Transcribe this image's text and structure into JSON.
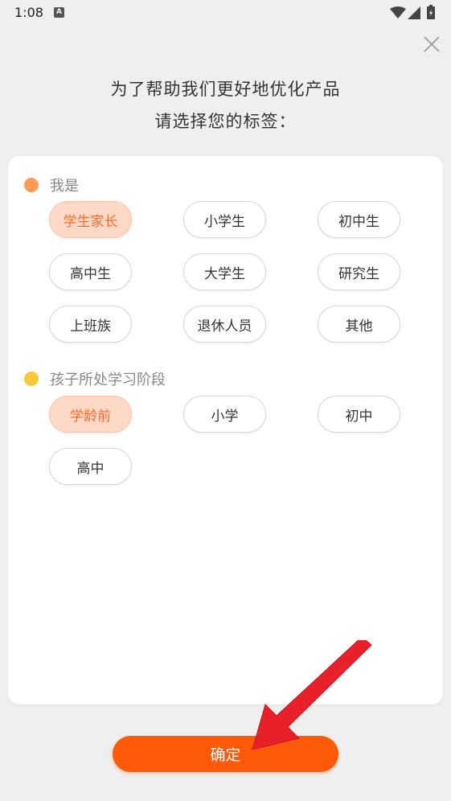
{
  "status_bar": {
    "time": "1:08",
    "notification_icon": "A"
  },
  "header": {
    "line1": "为了帮助我们更好地优化产品",
    "line2": "请选择您的标签："
  },
  "sections": [
    {
      "title": "我是",
      "dot_color": "#ff9a57",
      "options": [
        {
          "label": "学生家长",
          "selected": true
        },
        {
          "label": "小学生",
          "selected": false
        },
        {
          "label": "初中生",
          "selected": false
        },
        {
          "label": "高中生",
          "selected": false
        },
        {
          "label": "大学生",
          "selected": false
        },
        {
          "label": "研究生",
          "selected": false
        },
        {
          "label": "上班族",
          "selected": false
        },
        {
          "label": "退休人员",
          "selected": false
        },
        {
          "label": "其他",
          "selected": false
        }
      ]
    },
    {
      "title": "孩子所处学习阶段",
      "dot_color": "#f7c93c",
      "options": [
        {
          "label": "学龄前",
          "selected": true
        },
        {
          "label": "小学",
          "selected": false
        },
        {
          "label": "初中",
          "selected": false
        },
        {
          "label": "高中",
          "selected": false
        }
      ]
    }
  ],
  "confirm_label": "确定",
  "colors": {
    "accent": "#ff5a0a",
    "selected_bg": "#ffd9c7",
    "selected_text": "#ff6b2d",
    "annotation_arrow": "#e8202a"
  }
}
